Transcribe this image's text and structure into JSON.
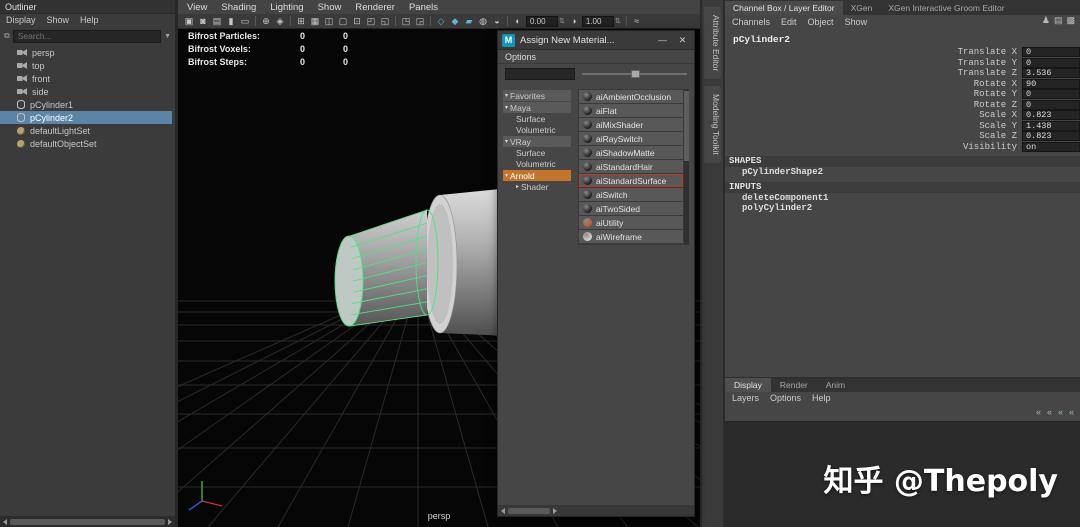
{
  "colors": {
    "selection_blue": "#5b85a5",
    "arnold_orange": "#c4752b",
    "selected_red": "#c0392b",
    "wireframe_green": "#4ee287",
    "maya_teal": "#0d98ba"
  },
  "outliner": {
    "title": "Outliner",
    "menus": [
      {
        "label": "Display"
      },
      {
        "label": "Show"
      },
      {
        "label": "Help"
      }
    ],
    "search_placeholder": "Search...",
    "items": [
      {
        "label": "persp",
        "icon": "camera",
        "selected": false
      },
      {
        "label": "top",
        "icon": "camera",
        "selected": false
      },
      {
        "label": "front",
        "icon": "camera",
        "selected": false
      },
      {
        "label": "side",
        "icon": "camera",
        "selected": false
      },
      {
        "label": "pCylinder1",
        "icon": "mesh",
        "selected": false
      },
      {
        "label": "pCylinder2",
        "icon": "mesh",
        "selected": true
      },
      {
        "label": "defaultLightSet",
        "icon": "set",
        "selected": false
      },
      {
        "label": "defaultObjectSet",
        "icon": "set",
        "selected": false
      }
    ]
  },
  "viewport": {
    "menus": [
      {
        "label": "View"
      },
      {
        "label": "Shading"
      },
      {
        "label": "Lighting"
      },
      {
        "label": "Show"
      },
      {
        "label": "Renderer"
      },
      {
        "label": "Panels"
      }
    ],
    "toolbar": [
      {
        "type": "icon",
        "name": "select-camera-icon",
        "glyph": "▣"
      },
      {
        "type": "icon",
        "name": "lock-camera-icon",
        "glyph": "◙"
      },
      {
        "type": "icon",
        "name": "camera-attributes-icon",
        "glyph": "▤"
      },
      {
        "type": "icon",
        "name": "bookmarks-icon",
        "glyph": "▮"
      },
      {
        "type": "icon",
        "name": "image-plane-icon",
        "glyph": "▭"
      },
      {
        "type": "sep"
      },
      {
        "type": "icon",
        "name": "two-d-pan-zoom-icon",
        "glyph": "⊕"
      },
      {
        "type": "icon",
        "name": "oversampling-icon",
        "glyph": "◈"
      },
      {
        "type": "sep"
      },
      {
        "type": "icon",
        "name": "grid-icon",
        "glyph": "⊞"
      },
      {
        "type": "icon",
        "name": "film-gate-icon",
        "glyph": "▦"
      },
      {
        "type": "icon",
        "name": "resolution-gate-icon",
        "glyph": "◫"
      },
      {
        "type": "icon",
        "name": "gate-mask-icon",
        "glyph": "▢"
      },
      {
        "type": "icon",
        "name": "field-chart-icon",
        "glyph": "⊡"
      },
      {
        "type": "icon",
        "name": "safe-action-icon",
        "glyph": "◰"
      },
      {
        "type": "icon",
        "name": "safe-title-icon",
        "glyph": "◱"
      },
      {
        "type": "sep"
      },
      {
        "type": "icon",
        "name": "frame-all-icon",
        "glyph": "◳"
      },
      {
        "type": "icon",
        "name": "frame-selection-icon",
        "glyph": "◲"
      },
      {
        "type": "sep"
      },
      {
        "type": "icon",
        "name": "wireframe-icon",
        "glyph": "◇",
        "color": "#5bb8d4"
      },
      {
        "type": "icon",
        "name": "shaded-icon",
        "glyph": "◆",
        "color": "#5bb8d4"
      },
      {
        "type": "icon",
        "name": "textured-icon",
        "glyph": "▰",
        "color": "#5bb8d4"
      },
      {
        "type": "icon",
        "name": "default-material-icon",
        "glyph": "◍"
      },
      {
        "type": "icon",
        "name": "shadows-icon",
        "glyph": "◒"
      },
      {
        "type": "sep"
      },
      {
        "type": "icon",
        "name": "exposure-icon",
        "glyph": "◐"
      },
      {
        "type": "field",
        "name": "exposure-field",
        "value": "0.00"
      },
      {
        "type": "icon",
        "name": "gamma-icon",
        "glyph": "◑"
      },
      {
        "type": "field",
        "name": "gamma-field",
        "value": "1.00"
      },
      {
        "type": "sep"
      },
      {
        "type": "icon",
        "name": "motion-blur-icon",
        "glyph": "≈"
      }
    ],
    "hud": [
      {
        "label": "Bifrost Particles:",
        "col1": "0",
        "col2": "0"
      },
      {
        "label": "Bifrost Voxels:",
        "col1": "0",
        "col2": "0"
      },
      {
        "label": "Bifrost Steps:",
        "col1": "0",
        "col2": "0"
      }
    ],
    "camera_label": "persp"
  },
  "dialog": {
    "title": "Assign New Material...",
    "logo": "M",
    "minimize_label": "—",
    "close_label": "✕",
    "menu": "Options",
    "tree": [
      {
        "label": "Favorites",
        "kind": "header",
        "arrow": "▾"
      },
      {
        "label": "Maya",
        "kind": "header",
        "arrow": "▾"
      },
      {
        "label": "Surface",
        "kind": "child"
      },
      {
        "label": "Volumetric",
        "kind": "child"
      },
      {
        "label": "VRay",
        "kind": "header",
        "arrow": "▾"
      },
      {
        "label": "Surface",
        "kind": "child"
      },
      {
        "label": "Volumetric",
        "kind": "child"
      },
      {
        "label": "Arnold",
        "kind": "header",
        "arrow": "▾",
        "highlight": true
      },
      {
        "label": "Shader",
        "kind": "child",
        "arrow": "▸"
      }
    ],
    "materials": [
      {
        "label": "aiAmbientOcclusion",
        "swatch": "#1a1a1a"
      },
      {
        "label": "aiFlat",
        "swatch": "#1a1a1a"
      },
      {
        "label": "aiMixShader",
        "swatch": "#1a1a1a"
      },
      {
        "label": "aiRaySwitch",
        "swatch": "#1a1a1a"
      },
      {
        "label": "aiShadowMatte",
        "swatch": "#1a1a1a"
      },
      {
        "label": "aiStandardHair",
        "swatch": "#1a1a1a"
      },
      {
        "label": "aiStandardSurface",
        "swatch": "#1a1a1a",
        "selected": true
      },
      {
        "label": "aiSwitch",
        "swatch": "#1a1a1a"
      },
      {
        "label": "aiTwoSided",
        "swatch": "#1a1a1a"
      },
      {
        "label": "aiUtility",
        "swatch": "#c05a2a"
      },
      {
        "label": "aiWireframe",
        "swatch": "#d8d8d8"
      }
    ]
  },
  "side_tabs": [
    {
      "label": "Attribute Editor"
    },
    {
      "label": "Modeling Toolkit"
    }
  ],
  "channel_box": {
    "tabs": [
      {
        "label": "Channel Box / Layer Editor",
        "active": true
      },
      {
        "label": "XGen",
        "active": false
      },
      {
        "label": "XGen Interactive Groom Editor",
        "active": false
      }
    ],
    "menus": [
      {
        "label": "Channels"
      },
      {
        "label": "Edit"
      },
      {
        "label": "Object"
      },
      {
        "label": "Show"
      }
    ],
    "corner_icons": [
      {
        "name": "user-icon",
        "glyph": "♟"
      },
      {
        "name": "lock-channels-icon",
        "glyph": "▤"
      },
      {
        "name": "channel-settings-icon",
        "glyph": "▩"
      }
    ],
    "object_name": "pCylinder2",
    "attributes": [
      {
        "label": "Translate X",
        "value": "0"
      },
      {
        "label": "Translate Y",
        "value": "0"
      },
      {
        "label": "Translate Z",
        "value": "3.536"
      },
      {
        "label": "Rotate X",
        "value": "90"
      },
      {
        "label": "Rotate Y",
        "value": "0"
      },
      {
        "label": "Rotate Z",
        "value": "0"
      },
      {
        "label": "Scale X",
        "value": "0.823"
      },
      {
        "label": "Scale Y",
        "value": "1.438"
      },
      {
        "label": "Scale Z",
        "value": "0.823"
      },
      {
        "label": "Visibility",
        "value": "on"
      }
    ],
    "sections": [
      {
        "header": "SHAPES",
        "nodes": [
          "pCylinderShape2"
        ]
      },
      {
        "header": "INPUTS",
        "nodes": [
          "deleteComponent1",
          "polyCylinder2"
        ]
      }
    ]
  },
  "layer_editor": {
    "tabs": [
      {
        "label": "Display",
        "active": true
      },
      {
        "label": "Render",
        "active": false
      },
      {
        "label": "Anim",
        "active": false
      }
    ],
    "menus": [
      {
        "label": "Layers"
      },
      {
        "label": "Options"
      },
      {
        "label": "Help"
      }
    ],
    "toolbar_icons": [
      {
        "name": "layer-move-icon",
        "glyph": "«"
      },
      {
        "name": "layer-add-icon",
        "glyph": "«"
      },
      {
        "name": "layer-empty-icon",
        "glyph": "«"
      },
      {
        "name": "layer-selected-icon",
        "glyph": "«"
      }
    ]
  },
  "watermark": {
    "text": "知乎 @Thepoly"
  }
}
